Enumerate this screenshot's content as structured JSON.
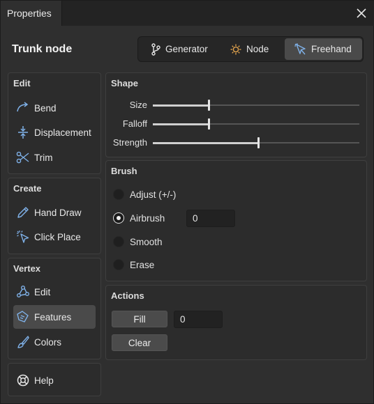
{
  "window": {
    "tab_title": "Properties"
  },
  "header": {
    "title": "Trunk node"
  },
  "modes": [
    {
      "label": "Generator",
      "icon": "branch-icon",
      "active": false
    },
    {
      "label": "Node",
      "icon": "sun-node-icon",
      "active": false
    },
    {
      "label": "Freehand",
      "icon": "freehand-cursor-icon",
      "active": true
    }
  ],
  "sidebar": {
    "edit": {
      "title": "Edit",
      "items": [
        {
          "label": "Bend",
          "icon": "bend-arrow-icon"
        },
        {
          "label": "Displacement",
          "icon": "vertical-arrows-icon"
        },
        {
          "label": "Trim",
          "icon": "scissors-icon"
        }
      ]
    },
    "create": {
      "title": "Create",
      "items": [
        {
          "label": "Hand Draw",
          "icon": "pencil-icon"
        },
        {
          "label": "Click Place",
          "icon": "click-cursor-icon"
        }
      ]
    },
    "vertex": {
      "title": "Vertex",
      "items": [
        {
          "label": "Edit",
          "icon": "vertex-nodes-icon"
        },
        {
          "label": "Features",
          "icon": "tag-icon",
          "selected": true
        },
        {
          "label": "Colors",
          "icon": "brush-icon"
        }
      ]
    },
    "help": {
      "label": "Help",
      "icon": "lifebuoy-icon"
    }
  },
  "shape": {
    "title": "Shape",
    "sliders": [
      {
        "label": "Size",
        "value": 0.27
      },
      {
        "label": "Falloff",
        "value": 0.27
      },
      {
        "label": "Strength",
        "value": 0.51
      }
    ]
  },
  "brush": {
    "title": "Brush",
    "options": [
      {
        "label": "Adjust (+/-)",
        "checked": false
      },
      {
        "label": "Airbrush",
        "checked": true
      },
      {
        "label": "Smooth",
        "checked": false
      },
      {
        "label": "Erase",
        "checked": false
      }
    ],
    "airbrush_value": "0"
  },
  "actions": {
    "title": "Actions",
    "fill_label": "Fill",
    "fill_value": "0",
    "clear_label": "Clear"
  },
  "colors": {
    "accent_icon": "#7fb1e8",
    "selected_bg": "#4a4a4a"
  }
}
